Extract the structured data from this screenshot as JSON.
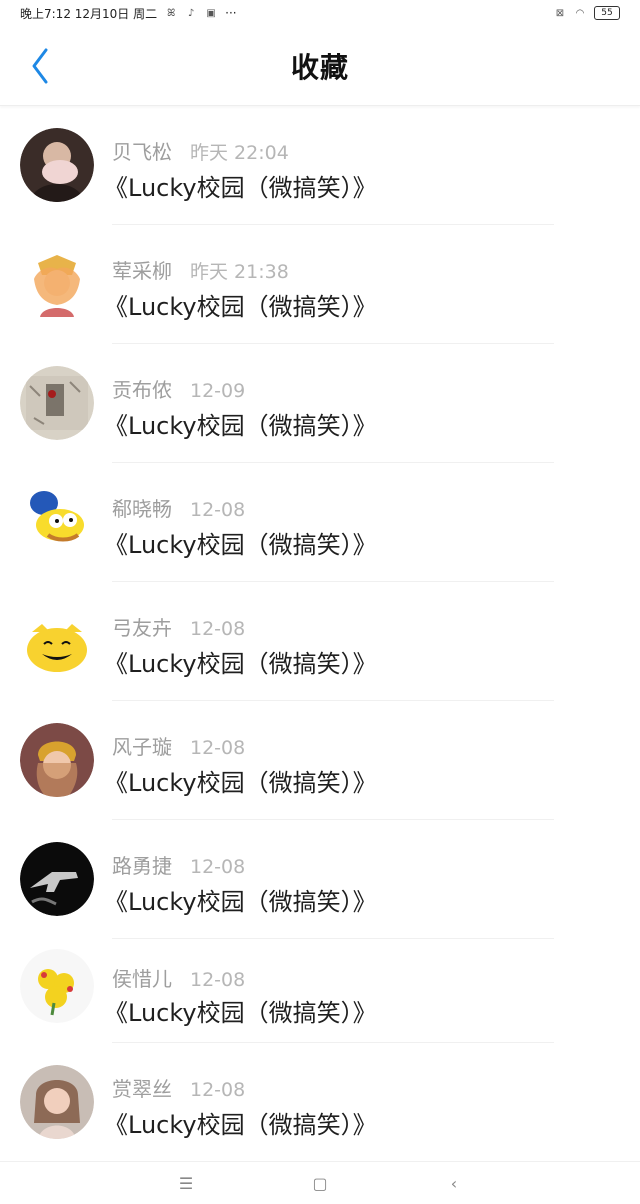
{
  "status_bar": {
    "time_date": "晚上7:12  12月10日 周二",
    "icons_left": [
      "wechat-icon",
      "tiktok-icon",
      "image-app-icon",
      "more-dots-icon"
    ],
    "more": "···",
    "battery": "55"
  },
  "header": {
    "title": "收藏"
  },
  "list": [
    {
      "author": "贝飞松",
      "time": "昨天 22:04",
      "title": "《Lucky校园（微搞笑）》"
    },
    {
      "author": "荤采柳",
      "time": "昨天 21:38",
      "title": "《Lucky校园（微搞笑）》"
    },
    {
      "author": "贡布侬",
      "time": "12-09",
      "title": "《Lucky校园（微搞笑）》"
    },
    {
      "author": "郗晓畅",
      "time": "12-08",
      "title": "《Lucky校园（微搞笑）》"
    },
    {
      "author": "弓友卉",
      "time": "12-08",
      "title": "《Lucky校园（微搞笑）》"
    },
    {
      "author": "风子璇",
      "time": "12-08",
      "title": "《Lucky校园（微搞笑）》"
    },
    {
      "author": "路勇捷",
      "time": "12-08",
      "title": "《Lucky校园（微搞笑）》"
    },
    {
      "author": "侯惜儿",
      "time": "12-08",
      "title": "《Lucky校园（微搞笑）》"
    },
    {
      "author": "赏翠丝",
      "time": "12-08",
      "title": "《Lucky校园（微搞笑）》"
    }
  ],
  "nav": {
    "menu_icon": "menu-icon",
    "home_icon": "home-icon",
    "back_icon": "back-triangle-icon"
  },
  "colors": {
    "accent": "#1e88e5",
    "author": "#9e9e9e",
    "time": "#b6b6b6",
    "title": "#1f1f1f"
  }
}
